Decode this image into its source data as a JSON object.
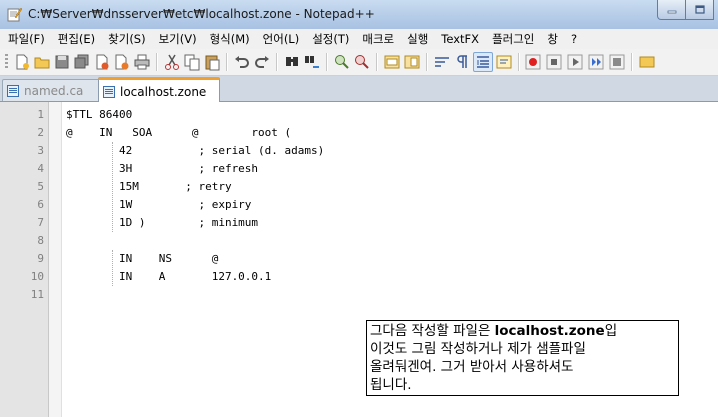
{
  "window": {
    "title": "C:₩Server₩dnsserver₩etc₩localhost.zone - Notepad++",
    "controls": [
      "minimize-icon",
      "maximize-icon"
    ]
  },
  "menu": [
    "파일(F)",
    "편집(E)",
    "찾기(S)",
    "보기(V)",
    "형식(M)",
    "언어(L)",
    "설정(T)",
    "매크로",
    "실행",
    "TextFX",
    "플러그인",
    "창",
    "?"
  ],
  "toolbar": {
    "icons": [
      "new-file-icon",
      "open-file-icon",
      "save-icon",
      "save-all-icon",
      "close-icon",
      "close-all-icon",
      "print-icon",
      "cut-icon",
      "copy-icon",
      "paste-icon",
      "undo-icon",
      "redo-icon",
      "find-icon",
      "replace-icon",
      "zoom-in-icon",
      "zoom-out-icon",
      "sync-vertical-icon",
      "sync-horizontal-icon",
      "word-wrap-icon",
      "show-all-chars-icon",
      "indent-guide-icon",
      "user-lang-icon",
      "record-macro-icon",
      "stop-macro-icon",
      "play-macro-icon",
      "run-macro-multiple-icon",
      "save-macro-icon"
    ],
    "active_icon": "indent-guide-icon"
  },
  "tabs": [
    {
      "label": "named.ca",
      "active": false
    },
    {
      "label": "localhost.zone",
      "active": true
    }
  ],
  "editor": {
    "lines": [
      {
        "no": "1",
        "text": "$TTL 86400"
      },
      {
        "no": "2",
        "text": "@    IN   SOA      @        root ("
      },
      {
        "no": "3",
        "text": "        42          ; serial (d. adams)"
      },
      {
        "no": "4",
        "text": "        3H          ; refresh"
      },
      {
        "no": "5",
        "text": "        15M       ; retry"
      },
      {
        "no": "6",
        "text": "        1W          ; expiry"
      },
      {
        "no": "7",
        "text": "        1D )        ; minimum"
      },
      {
        "no": "8",
        "text": ""
      },
      {
        "no": "9",
        "text": "        IN    NS      @"
      },
      {
        "no": "10",
        "text": "        IN    A       127.0.0.1"
      },
      {
        "no": "11",
        "text": ""
      }
    ]
  },
  "annotation": {
    "line1_prefix": "그다음 작성할 파일은 ",
    "line1_bold": "localhost.zone",
    "line1_suffix": "입",
    "line2": "이것도 그림 작성하거나 제가 샘플파일",
    "line3": "올려둬겐여. 그거 받아서 사용하셔도",
    "line4": "됩니다."
  },
  "colors": {
    "titlebar": "#b6cde8",
    "gutter": "#e4e4e4",
    "active_tab_accent": "#f0a030"
  }
}
